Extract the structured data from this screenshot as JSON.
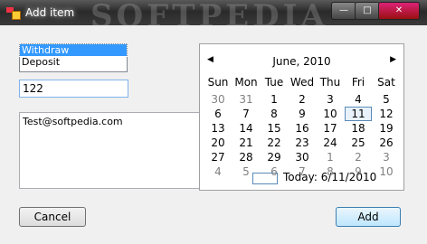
{
  "window": {
    "title": "Add item",
    "watermark": "SOFTPEDIA",
    "min_label": "—",
    "max_label": "□",
    "close_label": "✕"
  },
  "type_list": {
    "items": [
      "Withdraw",
      "Deposit"
    ],
    "selected": "Withdraw"
  },
  "amount": {
    "value": "122"
  },
  "memo": {
    "value": "Test@softpedia.com"
  },
  "calendar": {
    "month": "June, 2010",
    "prev_label": "◀",
    "next_label": "▶",
    "weekdays": [
      "Sun",
      "Mon",
      "Tue",
      "Wed",
      "Thu",
      "Fri",
      "Sat"
    ],
    "weeks": [
      [
        "30",
        "31",
        "1",
        "2",
        "3",
        "4",
        "5"
      ],
      [
        "6",
        "7",
        "8",
        "9",
        "10",
        "11",
        "12"
      ],
      [
        "13",
        "14",
        "15",
        "16",
        "17",
        "18",
        "19"
      ],
      [
        "20",
        "21",
        "22",
        "23",
        "24",
        "25",
        "26"
      ],
      [
        "27",
        "28",
        "29",
        "30",
        "1",
        "2",
        "3"
      ],
      [
        "4",
        "5",
        "6",
        "7",
        "8",
        "9",
        "10"
      ]
    ],
    "selected_day": "11",
    "today_label": "Today: 6/11/2010"
  },
  "buttons": {
    "cancel": "Cancel",
    "add": "Add"
  }
}
